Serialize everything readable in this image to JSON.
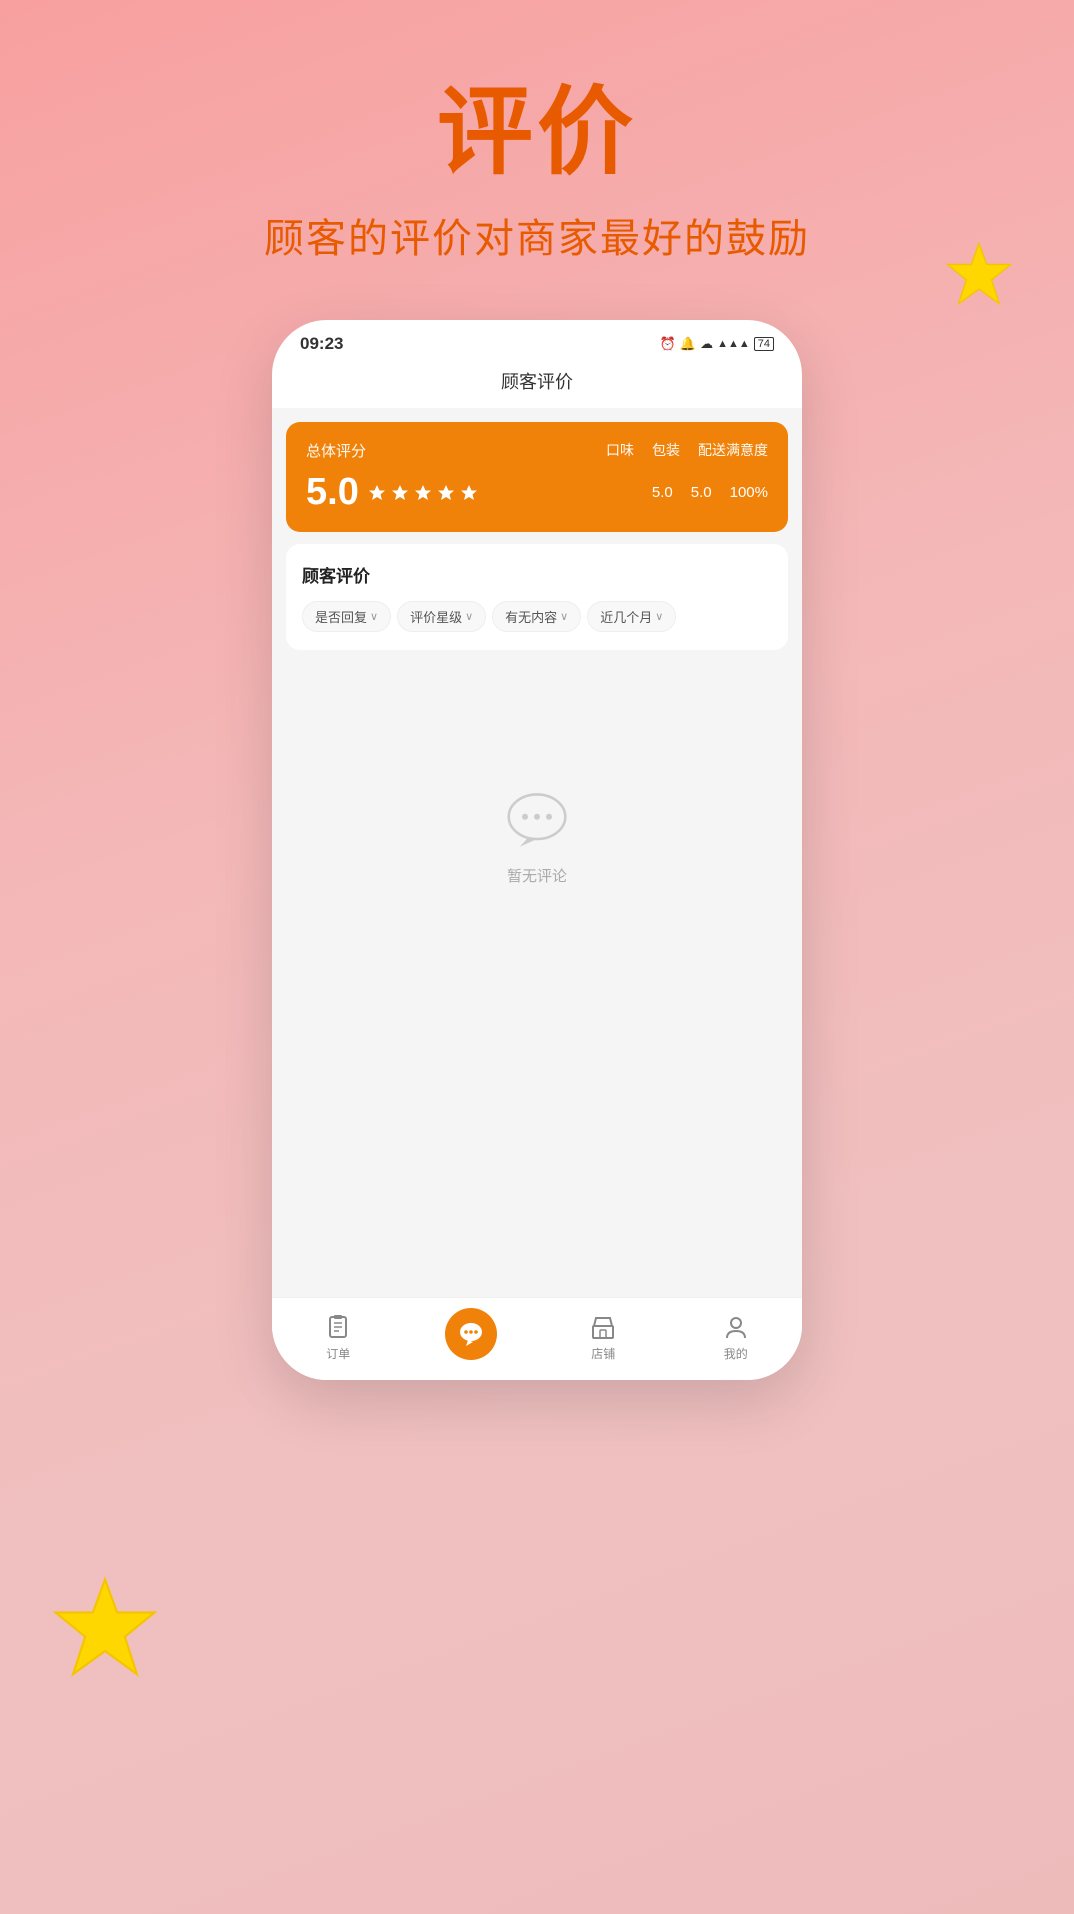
{
  "background": {
    "color": "#f4b0b0"
  },
  "header": {
    "title": "评价",
    "subtitle": "顾客的评价对商家最好的鼓励"
  },
  "phone": {
    "status_bar": {
      "time": "09:23",
      "icons": "⏰ 🔔 ☁ ▲ ▲ 74"
    },
    "nav_title": "顾客评价",
    "rating_card": {
      "label": "总体评分",
      "score": "5.0",
      "star_count": 5,
      "categories": [
        "口味",
        "包装",
        "配送满意度"
      ],
      "category_values": [
        "5.0",
        "5.0",
        "100%"
      ]
    },
    "reviews_section": {
      "title": "顾客评价",
      "filters": [
        {
          "label": "是否回复",
          "has_arrow": true
        },
        {
          "label": "评价星级",
          "has_arrow": true
        },
        {
          "label": "有无内容",
          "has_arrow": true
        },
        {
          "label": "近几个月",
          "has_arrow": true
        }
      ]
    },
    "empty_state": {
      "text": "暂无评论"
    },
    "tab_bar": {
      "items": [
        {
          "label": "订单",
          "icon": "order"
        },
        {
          "label": "",
          "icon": "chat_center",
          "is_center": true
        },
        {
          "label": "店铺",
          "icon": "shop"
        },
        {
          "label": "我的",
          "icon": "profile"
        }
      ]
    }
  }
}
